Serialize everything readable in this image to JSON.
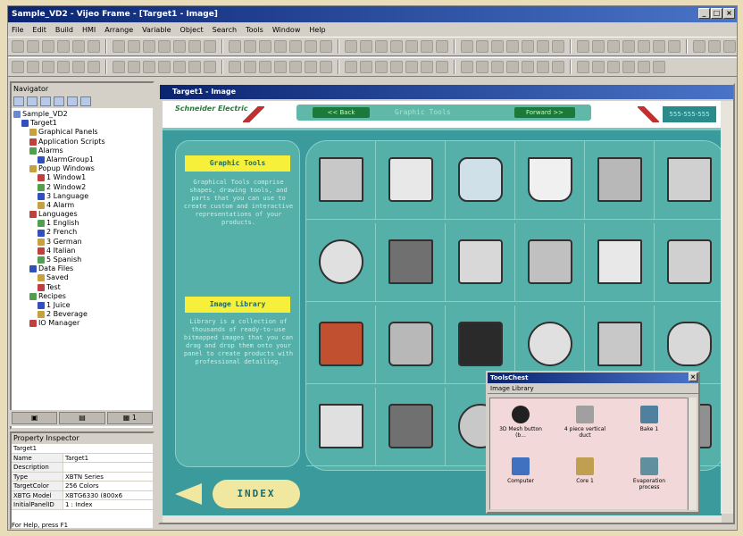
{
  "app": {
    "title": "Sample_VD2 - Vijeo Frame - [Target1 - Image]"
  },
  "menu": [
    "File",
    "Edit",
    "Build",
    "HMI",
    "Arrange",
    "Variable",
    "Object",
    "Search",
    "Tools",
    "Window",
    "Help"
  ],
  "navigator": {
    "title": "Navigator",
    "root": "Sample_VD2",
    "items": [
      {
        "label": "Target1",
        "depth": 1
      },
      {
        "label": "Graphical Panels",
        "depth": 2
      },
      {
        "label": "Application Scripts",
        "depth": 2
      },
      {
        "label": "Alarms",
        "depth": 2
      },
      {
        "label": "AlarmGroup1",
        "depth": 3
      },
      {
        "label": "Popup Windows",
        "depth": 2
      },
      {
        "label": "1 Window1",
        "depth": 3
      },
      {
        "label": "2 Window2",
        "depth": 3
      },
      {
        "label": "3 Language",
        "depth": 3
      },
      {
        "label": "4 Alarm",
        "depth": 3
      },
      {
        "label": "Languages",
        "depth": 2
      },
      {
        "label": "1 English",
        "depth": 3
      },
      {
        "label": "2 French",
        "depth": 3
      },
      {
        "label": "3 German",
        "depth": 3
      },
      {
        "label": "4 Italian",
        "depth": 3
      },
      {
        "label": "5 Spanish",
        "depth": 3
      },
      {
        "label": "Data Files",
        "depth": 2
      },
      {
        "label": "Saved",
        "depth": 3
      },
      {
        "label": "Test",
        "depth": 3
      },
      {
        "label": "Recipes",
        "depth": 2
      },
      {
        "label": "1 Juice",
        "depth": 3
      },
      {
        "label": "2 Beverage",
        "depth": 3
      },
      {
        "label": "IO Manager",
        "depth": 2
      }
    ]
  },
  "property": {
    "title": "Property Inspector",
    "target": "Target1",
    "rows": [
      {
        "key": "Name",
        "value": "Target1"
      },
      {
        "key": "Description",
        "value": ""
      },
      {
        "key": "Type",
        "value": "XBTN Series"
      },
      {
        "key": "TargetColor",
        "value": "256 Colors"
      },
      {
        "key": "XBTG Model",
        "value": "XBTG6330 (800x6"
      },
      {
        "key": "InitialPanelID",
        "value": "1 : Index"
      }
    ]
  },
  "status": "For Help, press F1",
  "image_window": {
    "title": "Target1 - Image",
    "brand": "Schneider Electric",
    "back": "<< Back",
    "nav_title": "Graphic Tools",
    "forward": "Forward >>",
    "phone": "555-555-555",
    "graphic_tools_label": "Graphic Tools",
    "graphic_tools_desc": "Graphical Tools comprise shapes, drawing tools, and parts that you can use to create custom and interactive representations of your products.",
    "image_library_label": "Image Library",
    "image_library_desc": "Library is a collection of thousands of ready-to-use bitmapped images that you can drag and drop them onto your panel to create products with professional detailing.",
    "index_label": "INDEX"
  },
  "toolbox": {
    "title": "ToolsChest",
    "section": "Image Library",
    "items": [
      "3D Mesh button (b...",
      "4 piece vertical duct",
      "Bake 1",
      "Computer",
      "Core 1",
      "Evaporation process"
    ]
  }
}
